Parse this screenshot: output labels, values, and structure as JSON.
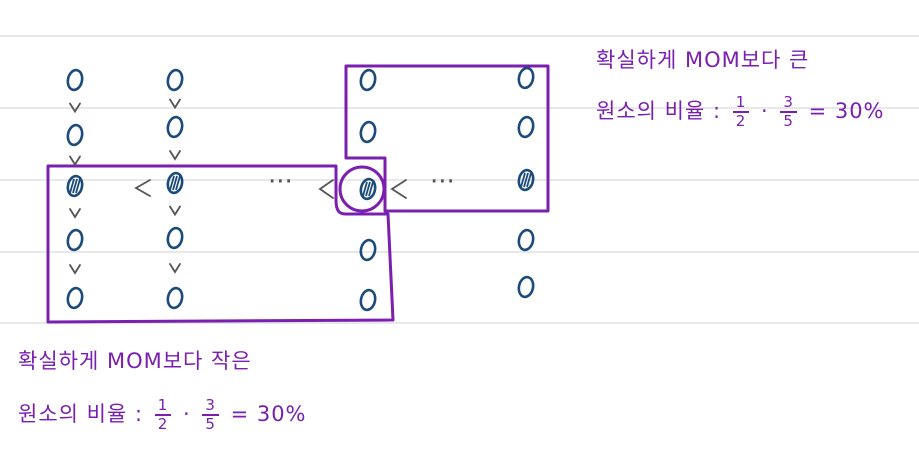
{
  "colors": {
    "ink_purple": "#7a1fb0",
    "ink_blue": "#1b4b7a",
    "ink_gray": "#555555",
    "rule_line": "#d9d9de",
    "paper": "#ffffff"
  },
  "diagram": {
    "columns": 5,
    "rows": 5,
    "element_symbol": "O",
    "highlighted_row_symbol": "⦶",
    "less_than": "<",
    "ellipsis": "···",
    "down_arrow": "v"
  },
  "note_top": {
    "line1": "확실하게 MOM보다 큰",
    "line2_prefix": "원소의 비율 :",
    "frac1": {
      "num": "1",
      "den": "2"
    },
    "dot": "·",
    "frac2": {
      "num": "3",
      "den": "5"
    },
    "result": "= 30%"
  },
  "note_bottom": {
    "line1": "확실하게 MOM보다 작은",
    "line2_prefix": "원소의 비율 :",
    "frac1": {
      "num": "1",
      "den": "2"
    },
    "dot": "·",
    "frac2": {
      "num": "3",
      "den": "5"
    },
    "result": "= 30%"
  }
}
